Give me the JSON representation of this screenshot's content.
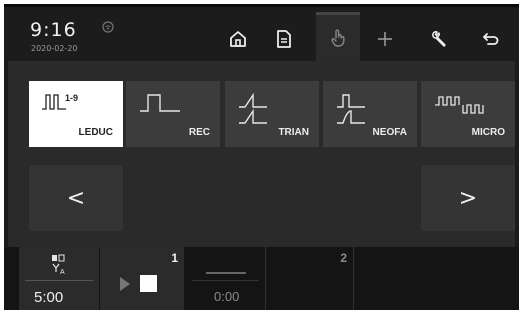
{
  "header": {
    "time": "9:16",
    "date": "2020-02-20",
    "status_icon": "wifi-icon",
    "nav": [
      {
        "name": "home-button",
        "icon": "home-icon"
      },
      {
        "name": "document-button",
        "icon": "document-icon"
      },
      {
        "name": "hand-button",
        "icon": "hand-pointer-icon",
        "active": true
      },
      {
        "name": "add-button",
        "icon": "plus-icon"
      },
      {
        "name": "settings-button",
        "icon": "wrench-icon"
      },
      {
        "name": "back-button",
        "icon": "return-arrow-icon"
      }
    ]
  },
  "waveforms": [
    {
      "label": "LEDUC",
      "tag": "1-9",
      "selected": true
    },
    {
      "label": "REC",
      "selected": false
    },
    {
      "label": "TRIAN",
      "selected": false
    },
    {
      "label": "NEOFA",
      "selected": false
    },
    {
      "label": "MICRO",
      "selected": false
    }
  ],
  "pager": {
    "prev": "<",
    "next": ">"
  },
  "bottom": {
    "timer": "5:00",
    "channel1": {
      "number": "1",
      "time": "0:00"
    },
    "channel2": {
      "number": "2"
    }
  },
  "colors": {
    "background": "#1b1b1b",
    "panel": "#2a2a2a",
    "button": "#3c3c3c",
    "selected": "#ffffff"
  }
}
